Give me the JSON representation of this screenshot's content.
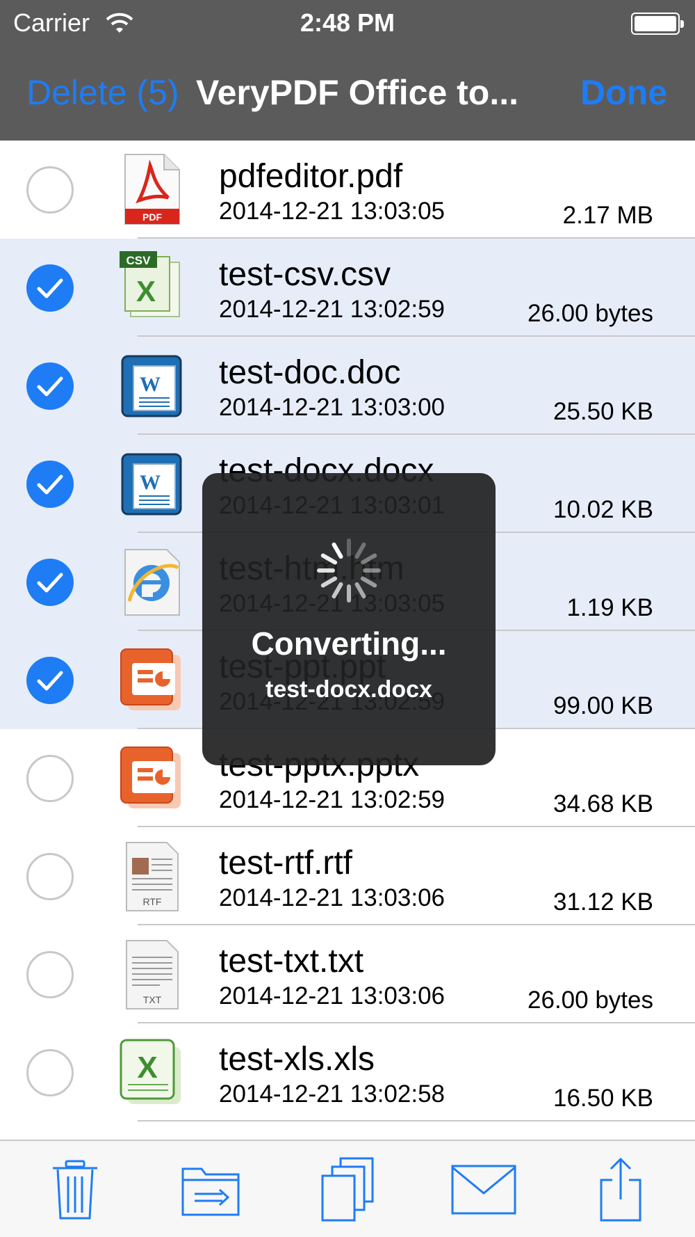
{
  "status_bar": {
    "carrier": "Carrier",
    "time": "2:48 PM"
  },
  "nav": {
    "left_button": "Delete (5)",
    "title": "VeryPDF Office to...",
    "right_button": "Done"
  },
  "colors": {
    "accent": "#1e7cf5",
    "bar": "#5b5b5b",
    "selected_row": "#e6edf9"
  },
  "files": [
    {
      "name": "pdfeditor.pdf",
      "date": "2014-12-21 13:03:05",
      "size": "2.17 MB",
      "selected": false,
      "icon": "pdf-icon"
    },
    {
      "name": "test-csv.csv",
      "date": "2014-12-21 13:02:59",
      "size": "26.00 bytes",
      "selected": true,
      "icon": "csv-icon"
    },
    {
      "name": "test-doc.doc",
      "date": "2014-12-21 13:03:00",
      "size": "25.50 KB",
      "selected": true,
      "icon": "word-icon"
    },
    {
      "name": "test-docx.docx",
      "date": "2014-12-21 13:03:01",
      "size": "10.02 KB",
      "selected": true,
      "icon": "word-icon"
    },
    {
      "name": "test-htm.htm",
      "date": "2014-12-21 13:03:05",
      "size": "1.19 KB",
      "selected": true,
      "icon": "ie-icon"
    },
    {
      "name": "test-ppt.ppt",
      "date": "2014-12-21 13:02:59",
      "size": "99.00 KB",
      "selected": true,
      "icon": "ppt-icon"
    },
    {
      "name": "test-pptx.pptx",
      "date": "2014-12-21 13:02:59",
      "size": "34.68 KB",
      "selected": false,
      "icon": "ppt-icon"
    },
    {
      "name": "test-rtf.rtf",
      "date": "2014-12-21 13:03:06",
      "size": "31.12 KB",
      "selected": false,
      "icon": "rtf-icon"
    },
    {
      "name": "test-txt.txt",
      "date": "2014-12-21 13:03:06",
      "size": "26.00 bytes",
      "selected": false,
      "icon": "txt-icon"
    },
    {
      "name": "test-xls.xls",
      "date": "2014-12-21 13:02:58",
      "size": "16.50 KB",
      "selected": false,
      "icon": "excel-icon"
    }
  ],
  "hud": {
    "message": "Converting...",
    "file": "test-docx.docx"
  },
  "toolbar": [
    {
      "name": "trash-icon"
    },
    {
      "name": "move-folder-icon"
    },
    {
      "name": "copy-icon"
    },
    {
      "name": "mail-icon"
    },
    {
      "name": "share-icon"
    }
  ]
}
